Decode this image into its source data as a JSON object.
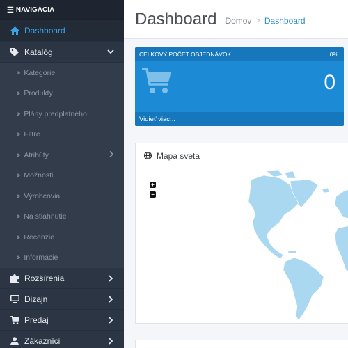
{
  "sidebar": {
    "header": "NAVIGÁCIA",
    "header_icon": "bars-icon",
    "items": [
      {
        "label": "Dashboard",
        "icon": "home-icon",
        "active": true
      },
      {
        "label": "Katalóg",
        "icon": "tag-icon",
        "expanded": true
      },
      {
        "label": "Rozšírenia",
        "icon": "puzzle-icon"
      },
      {
        "label": "Dizajn",
        "icon": "monitor-icon"
      },
      {
        "label": "Predaj",
        "icon": "cart-icon"
      },
      {
        "label": "Zákazníci",
        "icon": "user-icon"
      }
    ],
    "catalog_sub": [
      {
        "label": "Kategórie"
      },
      {
        "label": "Produkty"
      },
      {
        "label": "Plány predplatného"
      },
      {
        "label": "Filtre"
      },
      {
        "label": "Atribúty",
        "has_children": true
      },
      {
        "label": "Možnosti"
      },
      {
        "label": "Výrobcovia"
      },
      {
        "label": "Na stiahnutie"
      },
      {
        "label": "Recenzie"
      },
      {
        "label": "Informácie"
      }
    ]
  },
  "header": {
    "title": "Dashboard",
    "breadcrumb": {
      "home": "Domov",
      "separator": ">",
      "current": "Dashboard"
    }
  },
  "orders_tile": {
    "title": "CELKOVÝ POČET OBJEDNÁVOK",
    "percent": "0%",
    "value": "0",
    "link": "Vidieť viac...",
    "icon": "cart-icon",
    "color": "#1d8ad6"
  },
  "map_panel": {
    "title": "Mapa sveta",
    "icon": "globe-icon",
    "zoom_in": "+",
    "zoom_out": "−"
  },
  "colors": {
    "sidebar_bg": "#2b3544",
    "active_text": "#39a3e8",
    "map_land": "#a9d8f0"
  }
}
